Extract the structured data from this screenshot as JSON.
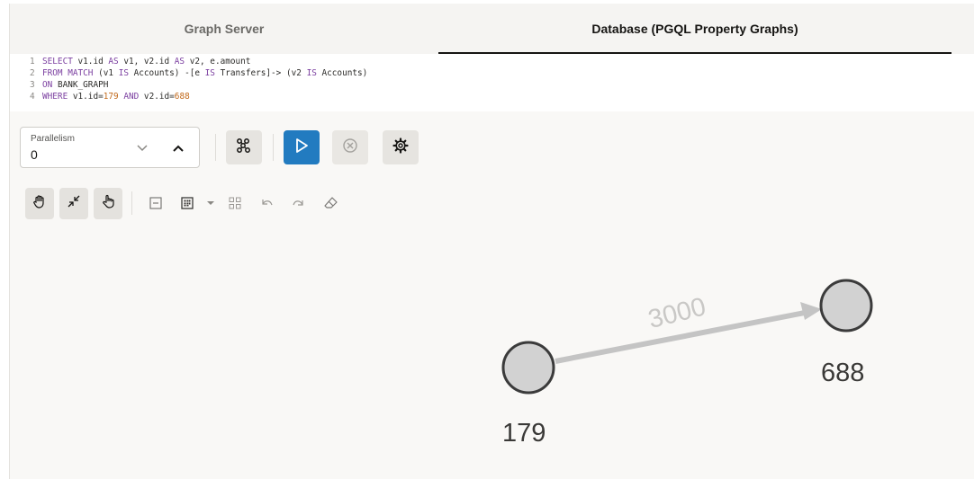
{
  "tabs": [
    {
      "label": "Graph Server",
      "active": false
    },
    {
      "label": "Database (PGQL Property Graphs)",
      "active": true
    }
  ],
  "editor": {
    "lines": [
      {
        "num": "1",
        "tokens": [
          {
            "t": "SELECT",
            "c": "kw"
          },
          {
            "t": " v1.id ",
            "c": "plain"
          },
          {
            "t": "AS",
            "c": "kw"
          },
          {
            "t": " v1, v2.id ",
            "c": "plain"
          },
          {
            "t": "AS",
            "c": "kw"
          },
          {
            "t": " v2, e.amount",
            "c": "plain"
          }
        ]
      },
      {
        "num": "2",
        "tokens": [
          {
            "t": "FROM MATCH",
            "c": "kw"
          },
          {
            "t": " (v1 ",
            "c": "plain"
          },
          {
            "t": "IS",
            "c": "kw"
          },
          {
            "t": " Accounts) -[e ",
            "c": "plain"
          },
          {
            "t": "IS",
            "c": "kw"
          },
          {
            "t": " Transfers]-> (v2 ",
            "c": "plain"
          },
          {
            "t": "IS",
            "c": "kw"
          },
          {
            "t": " Accounts)",
            "c": "plain"
          }
        ]
      },
      {
        "num": "3",
        "tokens": [
          {
            "t": "ON",
            "c": "kw"
          },
          {
            "t": " BANK_GRAPH",
            "c": "plain"
          }
        ]
      },
      {
        "num": "4",
        "tokens": [
          {
            "t": "WHERE",
            "c": "kw"
          },
          {
            "t": " v1.id=",
            "c": "plain"
          },
          {
            "t": "179",
            "c": "num"
          },
          {
            "t": " ",
            "c": "plain"
          },
          {
            "t": "AND",
            "c": "kw"
          },
          {
            "t": " v2.id=",
            "c": "plain"
          },
          {
            "t": "688",
            "c": "num"
          }
        ]
      }
    ]
  },
  "toolbar": {
    "parallelism_label": "Parallelism",
    "parallelism_value": "0",
    "decrease_icon": "chevron-down-icon",
    "increase_icon": "chevron-up-icon",
    "buttons": [
      {
        "name": "graph-modify-button",
        "icon": "graph-nodes-icon"
      },
      {
        "name": "run-button",
        "icon": "play-icon"
      },
      {
        "name": "cancel-button",
        "icon": "circle-x-icon"
      },
      {
        "name": "settings-button",
        "icon": "gear-icon"
      }
    ],
    "accent_color": "#227bc0"
  },
  "graph_tools": [
    "pan-hand-icon",
    "collapse-arrows-icon",
    "select-hand-icon",
    "minus-box-icon",
    "layout-grid-icon",
    "dropdown-caret-icon",
    "group-nodes-icon",
    "undo-icon",
    "redo-icon",
    "eraser-icon"
  ],
  "graph": {
    "nodes": [
      {
        "id": "179",
        "label": "179"
      },
      {
        "id": "688",
        "label": "688"
      }
    ],
    "edges": [
      {
        "from": "179",
        "to": "688",
        "label": "3000"
      }
    ],
    "node_fill": "#d2d2d2",
    "node_stroke": "#3b3b3b",
    "edge_color": "#c4c4c4"
  }
}
